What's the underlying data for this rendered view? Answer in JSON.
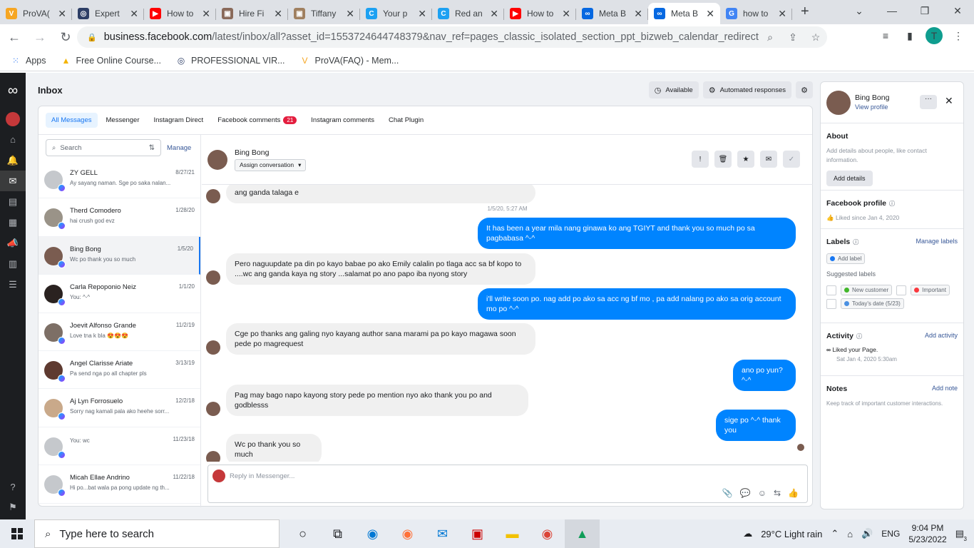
{
  "browser": {
    "tabs": [
      {
        "title": "ProVA(",
        "color": "#f6a623",
        "glyph": "V"
      },
      {
        "title": "Expert",
        "color": "#2d3e66",
        "glyph": "◎"
      },
      {
        "title": "How to",
        "color": "#ff0000",
        "glyph": "▶"
      },
      {
        "title": "Hire Fi",
        "color": "#8a6a5a",
        "glyph": "▣"
      },
      {
        "title": "Tiffany",
        "color": "#a08060",
        "glyph": "▣"
      },
      {
        "title": "Your p",
        "color": "#1da1f2",
        "glyph": "C"
      },
      {
        "title": "Red an",
        "color": "#1da1f2",
        "glyph": "C"
      },
      {
        "title": "How to",
        "color": "#ff0000",
        "glyph": "▶"
      },
      {
        "title": "Meta B",
        "color": "#0668e1",
        "glyph": "∞"
      },
      {
        "title": "Meta B",
        "color": "#0668e1",
        "glyph": "∞"
      },
      {
        "title": "how to",
        "color": "#4285f4",
        "glyph": "G"
      }
    ],
    "url_host": "business.facebook.com",
    "url_path": "/latest/inbox/all?asset_id=1553724644748379&nav_ref=pages_classic_isolated_section_ppt_bizweb_calendar_redirect&mailbox_id=&s...",
    "profile_initial": "T",
    "bookmarks": [
      {
        "label": "Apps",
        "icon": "apps-grid-icon"
      },
      {
        "label": "Free Online Course...",
        "icon": "drive-icon"
      },
      {
        "label": "PROFESSIONAL VIR...",
        "icon": "globe-icon"
      },
      {
        "label": "ProVA(FAQ) - Mem...",
        "icon": "prova-icon"
      }
    ]
  },
  "inbox": {
    "title": "Inbox",
    "available": "Available",
    "automated": "Automated responses",
    "filters": [
      {
        "label": "All Messages",
        "selected": true
      },
      {
        "label": "Messenger"
      },
      {
        "label": "Instagram Direct"
      },
      {
        "label": "Facebook comments",
        "badge": "21"
      },
      {
        "label": "Instagram comments"
      },
      {
        "label": "Chat Plugin"
      }
    ],
    "search_placeholder": "Search",
    "manage": "Manage",
    "conversations": [
      {
        "name": "ZY GELL",
        "preview": "Ay sayang naman. Sge po saka nalan...",
        "date": "8/27/21"
      },
      {
        "name": "Therd Comodero",
        "preview": "hai crush god evz",
        "date": "1/28/20"
      },
      {
        "name": "Bing Bong",
        "preview": "Wc po thank you so much",
        "date": "1/5/20",
        "selected": true
      },
      {
        "name": "Carla Repoponio Neiz",
        "preview": "You: ^-^",
        "date": "1/1/20"
      },
      {
        "name": "Joevit Alfonso Grande",
        "preview": "Love tna k bla 😍😍😍",
        "date": "11/2/19"
      },
      {
        "name": "Angel Clarisse Ariate",
        "preview": "Pa send nga po all chapter pls",
        "date": "3/13/19"
      },
      {
        "name": "Aj Lyn Forrosuelo",
        "preview": "Sorry nag kamali pala ako heehe sorr...",
        "date": "12/2/18"
      },
      {
        "name": "",
        "preview": "You: wc",
        "date": "11/23/18"
      },
      {
        "name": "Micah Ellae Andrino",
        "preview": "Hi po...bat wala pa pong update ng th...",
        "date": "11/22/18"
      }
    ]
  },
  "thread": {
    "name": "Bing Bong",
    "assign": "Assign conversation",
    "timestamp": "1/5/20, 5:27 AM",
    "messages": [
      {
        "dir": "in",
        "text": "ang ganda talaga e"
      },
      {
        "dir": "out",
        "text": "It has been a year mila nang ginawa ko ang TGIYT and thank you so much po sa pagbabasa ^-^"
      },
      {
        "dir": "in",
        "text": "Pero naguupdate pa din po kayo babae po ako Emily calalin po tlaga acc sa bf kopo to ....wc ang ganda kaya ng story ...salamat po ano papo iba nyong story"
      },
      {
        "dir": "out",
        "text": "i'll write soon po. nag add po ako sa acc ng bf mo , pa add nalang po ako sa orig account mo po ^-^"
      },
      {
        "dir": "in",
        "text": "Cge po thanks ang galing nyo kayang author sana marami pa po kayo magawa soon pede po magrequest"
      },
      {
        "dir": "out",
        "text": "ano po yun? ^-^"
      },
      {
        "dir": "in",
        "text": "Pag may bago napo kayong story pede po mention nyo ako thank you po and godblesss"
      },
      {
        "dir": "out",
        "text": "sige po ^-^ thank you"
      },
      {
        "dir": "in",
        "text": "Wc po thank you so much"
      }
    ],
    "reply_placeholder": "Reply in Messenger..."
  },
  "profile": {
    "name": "Bing Bong",
    "view_profile": "View profile",
    "about_title": "About",
    "about_text": "Add details about people, like contact information.",
    "add_details": "Add details",
    "fb_profile_title": "Facebook profile",
    "liked_since": "Liked since Jan 4, 2020",
    "labels_title": "Labels",
    "manage_labels": "Manage labels",
    "add_label": "Add label",
    "suggested": "Suggested labels",
    "new_customer": "New customer",
    "important": "Important",
    "todays_date": "Today's date (5/23)",
    "activity_title": "Activity",
    "add_activity": "Add activity",
    "activity_text": "Liked your Page.",
    "activity_date": "Sat Jan 4, 2020 5:30am",
    "notes_title": "Notes",
    "add_note": "Add note",
    "notes_text": "Keep track of important customer interactions."
  },
  "taskbar": {
    "search": "Type here to search",
    "weather": "29°C  Light rain",
    "lang": "ENG",
    "time": "9:04 PM",
    "date": "5/23/2022",
    "notif_count": "3"
  }
}
